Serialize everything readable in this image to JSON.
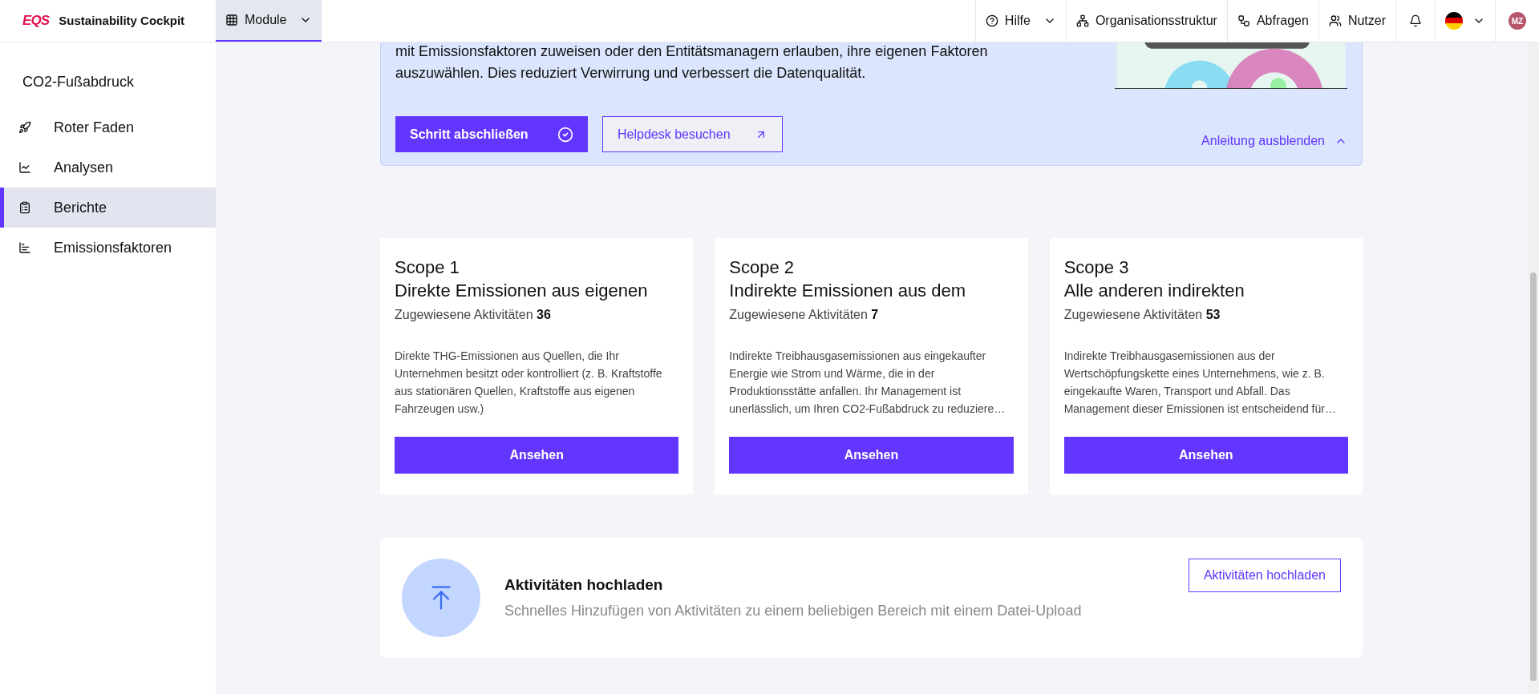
{
  "header": {
    "logo": "EQS",
    "app_name": "Sustainability Cockpit",
    "module_menu": {
      "label": "Module",
      "selected": true
    },
    "nav": [
      {
        "kind": "help",
        "label": "Hilfe"
      },
      {
        "kind": "org",
        "label": "Organisationsstruktur"
      },
      {
        "kind": "queries",
        "label": "Abfragen"
      },
      {
        "kind": "users",
        "label": "Nutzer"
      }
    ],
    "avatar": "MZ"
  },
  "sidebar": {
    "title": "CO2-Fußabdruck",
    "items": [
      {
        "kind": "rocket",
        "label": "Roter Faden",
        "selected": false
      },
      {
        "kind": "chart",
        "label": "Analysen",
        "selected": false
      },
      {
        "kind": "clipboard",
        "label": "Berichte",
        "selected": true
      },
      {
        "kind": "bars",
        "label": "Emissionsfaktoren",
        "selected": false
      }
    ]
  },
  "guide": {
    "lines": [
      "mit Emissionsfaktoren zuweisen oder den Entitätsmanagern erlauben, ihre eigenen Faktoren",
      "auszuwählen. Dies reduziert Verwirrung und verbessert die Datenqualität."
    ],
    "complete_button": "Schritt abschließen",
    "helpdesk_button": "Helpdesk besuchen",
    "hide_link": "Anleitung ausblenden"
  },
  "scopes": [
    {
      "title": "Scope 1",
      "subtitle": "Direkte Emissionen aus eigenen",
      "count_label": "Zugewiesene Aktivitäten",
      "count": "36",
      "description": "Direkte THG-Emissionen aus Quellen, die Ihr Unternehmen besitzt oder kontrolliert (z. B. Kraftstoffe aus stationären Quellen, Kraftstoffe aus eigenen Fahrzeugen usw.)",
      "button": "Ansehen"
    },
    {
      "title": "Scope 2",
      "subtitle": "Indirekte Emissionen aus dem",
      "count_label": "Zugewiesene Aktivitäten",
      "count": "7",
      "description": "Indirekte Treibhausgasemissionen aus eingekaufter Energie wie Strom und Wärme, die in der Produktionsstätte anfallen. Ihr Management ist unerlässlich, um Ihren CO2-Fußabdruck zu reduziere…",
      "button": "Ansehen"
    },
    {
      "title": "Scope 3",
      "subtitle": "Alle anderen indirekten",
      "count_label": "Zugewiesene Aktivitäten",
      "count": "53",
      "description": "Indirekte Treibhausgasemissionen aus der Wertschöpfungskette eines Unternehmens, wie z. B. eingekaufte Waren, Transport und Abfall. Das Management dieser Emissionen ist entscheidend für…",
      "button": "Ansehen"
    }
  ],
  "upload": {
    "title": "Aktivitäten hochladen",
    "description": "Schnelles Hinzufügen von Aktivitäten zu einem beliebigen Bereich mit einem Datei-Upload",
    "button": "Aktivitäten hochladen"
  }
}
